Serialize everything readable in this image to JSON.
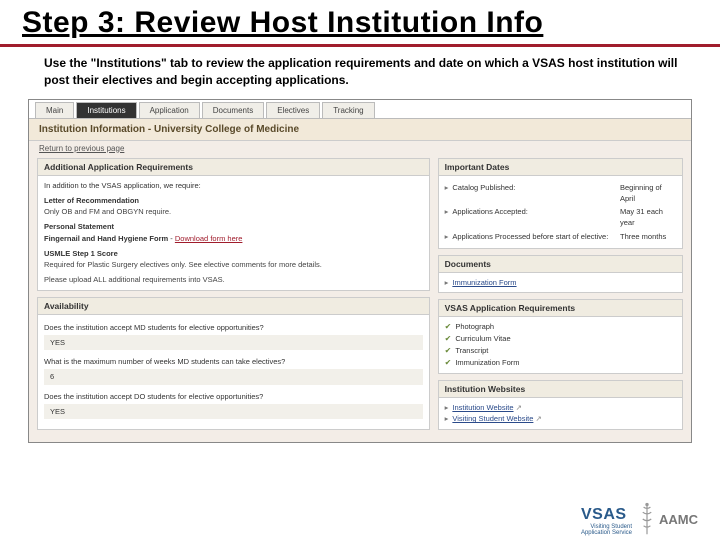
{
  "slide": {
    "title": "Step 3: Review Host Institution Info",
    "description": "Use the \"Institutions\" tab to review the application requirements and date on which a VSAS host institution will post their electives and begin accepting applications."
  },
  "tabs": [
    "Main",
    "Institutions",
    "Application",
    "Documents",
    "Electives",
    "Tracking"
  ],
  "information_header": "Institution Information - University College of Medicine",
  "back_link": "Return to previous page",
  "additional": {
    "header": "Additional Application Requirements",
    "intro": "In addition to the VSAS application, we require:",
    "lor_label": "Letter of Recommendation",
    "lor_note": "Only OB and FM and OBGYN require.",
    "ps_label": "Personal Statement",
    "form_label": "Fingernail and Hand Hygiene Form",
    "form_link": "Download form here",
    "usmle_label": "USMLE Step 1 Score",
    "usmle_note": "Required for Plastic Surgery electives only. See elective comments for more details.",
    "upload_note": "Please upload ALL additional requirements into VSAS."
  },
  "availability": {
    "header": "Availability",
    "q1": "Does the institution accept MD students for elective opportunities?",
    "a1": "YES",
    "q2": "What is the maximum number of weeks MD students can take electives?",
    "a2": "6",
    "q3": "Does the institution accept DO students for elective opportunities?",
    "a3": "YES"
  },
  "dates": {
    "header": "Important Dates",
    "rows": [
      {
        "k": "Catalog Published:",
        "v": "Beginning of April"
      },
      {
        "k": "Applications Accepted:",
        "v": "May 31 each year"
      },
      {
        "k": "Applications Processed before start of elective:",
        "v": "Three months"
      }
    ]
  },
  "docs": {
    "header": "Documents",
    "items": [
      "Immunization Form"
    ]
  },
  "vsas_req": {
    "header": "VSAS Application Requirements",
    "items": [
      "Photograph",
      "Curriculum Vitae",
      "Transcript",
      "Immunization Form"
    ]
  },
  "websites": {
    "header": "Institution Websites",
    "items": [
      "Institution Website",
      "Visiting Student Website"
    ]
  },
  "logos": {
    "vsas": "VSAS",
    "vsas_sub1": "Visiting Student",
    "vsas_sub2": "Application Service",
    "aamc": "AAMC"
  }
}
